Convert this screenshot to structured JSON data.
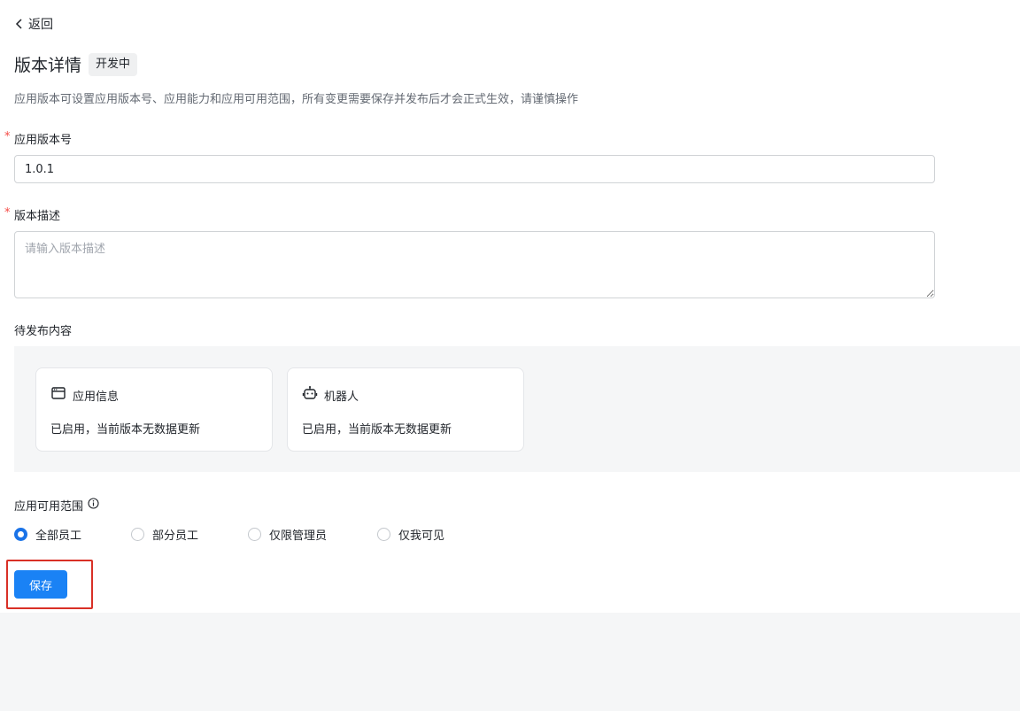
{
  "nav": {
    "back_label": "返回"
  },
  "header": {
    "title": "版本详情",
    "status_tag": "开发中",
    "description": "应用版本可设置应用版本号、应用能力和应用可用范围，所有变更需要保存并发布后才会正式生效，请谨慎操作"
  },
  "form": {
    "version": {
      "label": "应用版本号",
      "required_mark": "*",
      "value": "1.0.1"
    },
    "description": {
      "label": "版本描述",
      "required_mark": "*",
      "value": "",
      "placeholder": "请输入版本描述"
    }
  },
  "pending": {
    "label": "待发布内容",
    "cards": [
      {
        "title": "应用信息",
        "status": "已启用，当前版本无数据更新",
        "icon": "app-window-icon"
      },
      {
        "title": "机器人",
        "status": "已启用，当前版本无数据更新",
        "icon": "robot-icon"
      }
    ]
  },
  "scope": {
    "label": "应用可用范围",
    "info_icon": "info-icon",
    "options": [
      {
        "label": "全部员工",
        "checked": true
      },
      {
        "label": "部分员工",
        "checked": false
      },
      {
        "label": "仅限管理员",
        "checked": false
      },
      {
        "label": "仅我可见",
        "checked": false
      }
    ]
  },
  "actions": {
    "save_label": "保存"
  },
  "colors": {
    "primary": "#1a82f5",
    "radio_checked": "#1a73e8",
    "required": "#f54a45",
    "highlight": "#d93026"
  }
}
